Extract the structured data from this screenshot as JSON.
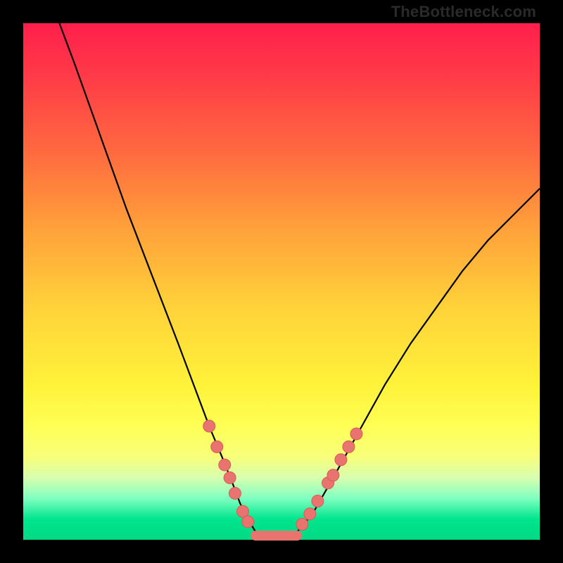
{
  "watermark": "TheBottleneck.com",
  "colors": {
    "frame": "#000000",
    "curve": "#000000",
    "marker_fill": "#e9746f",
    "marker_stroke": "#d45d57",
    "gradient_top": "#ff1f4b",
    "gradient_bottom": "#00d982"
  },
  "chart_data": {
    "type": "line",
    "title": "",
    "xlabel": "",
    "ylabel": "",
    "xlim": [
      0,
      100
    ],
    "ylim": [
      0,
      100
    ],
    "grid": false,
    "series": [
      {
        "name": "bottleneck-curve",
        "x": [
          7,
          10,
          15,
          20,
          25,
          30,
          33,
          36,
          38.5,
          40.5,
          42,
          43.5,
          45,
          47,
          49,
          51,
          53,
          56,
          60,
          65,
          70,
          75,
          80,
          85,
          90,
          95,
          100
        ],
        "values": [
          100,
          92,
          78,
          64,
          51,
          38,
          30,
          22,
          16,
          11,
          7,
          4,
          1.5,
          0.5,
          0.5,
          0.5,
          1.5,
          5,
          12,
          21,
          30,
          38,
          45,
          52,
          58,
          63,
          68
        ]
      }
    ],
    "markers": {
      "left_cluster": [
        {
          "x": 36,
          "y": 22
        },
        {
          "x": 37.5,
          "y": 18
        },
        {
          "x": 39,
          "y": 14.5
        },
        {
          "x": 40,
          "y": 12
        },
        {
          "x": 41,
          "y": 9
        },
        {
          "x": 42.5,
          "y": 5.5
        },
        {
          "x": 43.5,
          "y": 3.5
        }
      ],
      "right_cluster": [
        {
          "x": 54,
          "y": 3
        },
        {
          "x": 55.5,
          "y": 5
        },
        {
          "x": 57,
          "y": 7.5
        },
        {
          "x": 59,
          "y": 11
        },
        {
          "x": 60,
          "y": 12.5
        },
        {
          "x": 61.5,
          "y": 15.5
        },
        {
          "x": 63,
          "y": 18
        },
        {
          "x": 64.5,
          "y": 20.5
        }
      ],
      "bottom_flat": {
        "x_start": 45,
        "x_end": 53,
        "y": 0.8
      }
    }
  }
}
